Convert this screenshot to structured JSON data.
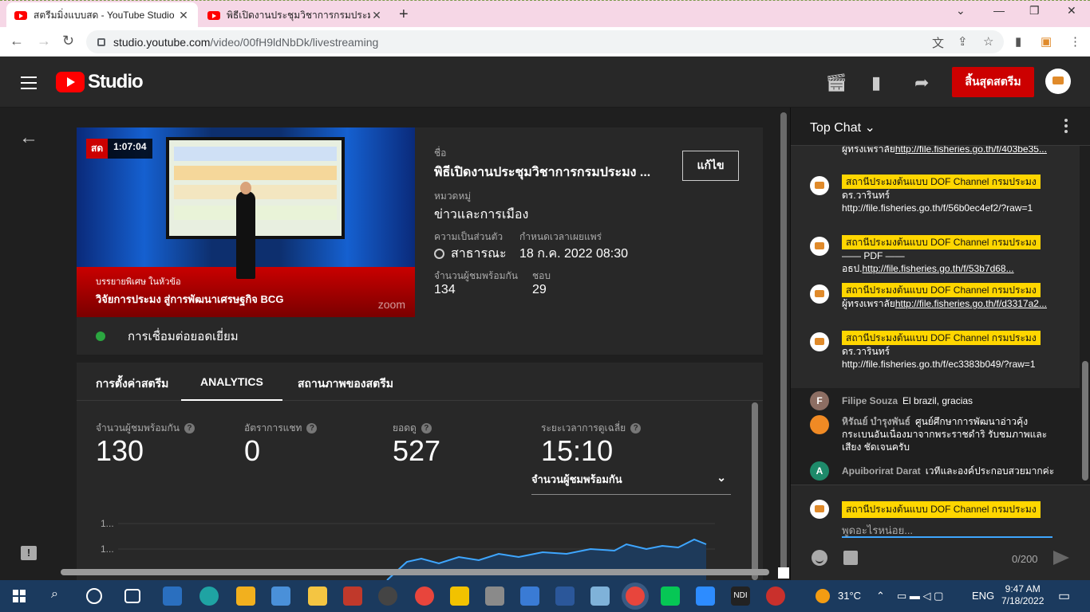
{
  "browser": {
    "tabs": [
      {
        "title": "สตรีมมิ่งแบบสด - YouTube Studio",
        "active": true
      },
      {
        "title": "พิธีเปิดงานประชุมวิชาการกรมประมง ปี",
        "active": false
      }
    ],
    "url_host": "studio.youtube.com",
    "url_path": "/video/00fH9ldNbDk/livestreaming"
  },
  "header": {
    "logo_text": "Studio",
    "end_stream_label": "สิ้นสุดสตรีม"
  },
  "video": {
    "live_tag": "สด",
    "duration": "1:07:04",
    "caption_small": "บรรยายพิเศษ ในหัวข้อ",
    "caption_main": "วิจัยการประมง สู่การพัฒนาเศรษฐกิจ BCG",
    "watermark": "zoom",
    "title_label": "ชื่อ",
    "title": "พิธีเปิดงานประชุมวิชาการกรมประมง ...",
    "edit_label": "แก้ไข",
    "category_label": "หมวดหมู่",
    "category": "ข่าวและการเมือง",
    "privacy_label": "ความเป็นส่วนตัว",
    "privacy": "สาธารณะ",
    "schedule_label": "กำหนดเวลาเผยแพร่",
    "schedule": "18 ก.ค. 2022 08:30",
    "concurrent_label": "จำนวนผู้ชมพร้อมกัน",
    "concurrent": "134",
    "likes_label": "ชอบ",
    "likes": "29",
    "connection_status": "การเชื่อมต่อยอดเยี่ยม"
  },
  "analytics": {
    "tabs": [
      "การตั้งค่าสตรีม",
      "ANALYTICS",
      "สถานภาพของสตรีม"
    ],
    "active_tab": "ANALYTICS",
    "metrics": [
      {
        "label": "จำนวนผู้ชมพร้อมกัน",
        "value": "130"
      },
      {
        "label": "อัตราการแชท",
        "value": "0"
      },
      {
        "label": "ยอดดู",
        "value": "527"
      },
      {
        "label": "ระยะเวลาการดูเฉลี่ย",
        "value": "15:10"
      }
    ],
    "dropdown_value": "จำนวนผู้ชมพร้อมกัน",
    "chart_ticks": [
      "1...",
      "1..."
    ]
  },
  "chat": {
    "title": "Top Chat",
    "messages": [
      {
        "author": "",
        "text_pre": "ผู้ทรงเพราลัย",
        "link": "http://file.fisheries.go.th/f/403be35..."
      },
      {
        "author": "สถานีประมงต้นแบบ DOF Channel กรมประมง",
        "text_pre": "ดร.วารินทร์",
        "text_post": "http://file.fisheries.go.th/f/56b0ec4ef2/?raw=1"
      },
      {
        "author": "สถานีประมงต้นแบบ DOF Channel กรมประมง",
        "text_pre": "—— PDF ——อธป.",
        "link": "http://file.fisheries.go.th/f/53b7d68..."
      },
      {
        "author": "สถานีประมงต้นแบบ DOF Channel กรมประมง",
        "text_pre": "ผู้ทรงเพราลัย",
        "link": "http://file.fisheries.go.th/f/d3317a2..."
      },
      {
        "author": "สถานีประมงต้นแบบ DOF Channel กรมประมง",
        "text_pre": "ดร.วารินทร์",
        "text_post": "http://file.fisheries.go.th/f/ec3383b049/?raw=1"
      },
      {
        "author": "Filipe Souza",
        "text": "El brazil, gracias",
        "initial": "F"
      },
      {
        "author": "หิรัณย์ บำรุงพันธ์",
        "text": "ศูนย์ศึกษาการพัฒนาอ่าวคุ้งกระเบนอันเนื่องมาจากพระราชดำริ รับชมภาพและเสียง ชัดเจนครับ"
      },
      {
        "author": "Apuiborirat Darat",
        "text": "เวทีและองค์ประกอบสวยมากค่ะ",
        "initial": "A"
      }
    ],
    "input_author": "สถานีประมงต้นแบบ DOF Channel กรมประมง",
    "input_placeholder": "พูดอะไรหน่อย...",
    "char_counter": "0/200"
  },
  "taskbar": {
    "temperature": "31°C",
    "language": "ENG",
    "time": "9:47 AM",
    "date": "7/18/2022"
  }
}
